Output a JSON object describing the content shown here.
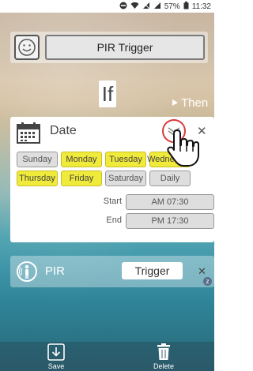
{
  "status_bar": {
    "battery_percent": "57%",
    "time": "11:32"
  },
  "header": {
    "title": "PIR Trigger",
    "icon": "smiley-face-icon"
  },
  "flow": {
    "if_label": "If",
    "then_label": "Then"
  },
  "date_condition": {
    "label": "Date",
    "days": [
      {
        "label": "Sunday",
        "selected": false
      },
      {
        "label": "Monday",
        "selected": true
      },
      {
        "label": "Tuesday",
        "selected": true
      },
      {
        "label": "Wednesday",
        "selected": true
      },
      {
        "label": "Thursday",
        "selected": true
      },
      {
        "label": "Friday",
        "selected": true
      },
      {
        "label": "Saturday",
        "selected": false
      },
      {
        "label": "Daily",
        "selected": false
      }
    ],
    "start_label": "Start",
    "start_value": "AM 07:30",
    "end_label": "End",
    "end_value": "PM 17:30"
  },
  "pir_trigger": {
    "label": "PIR",
    "value": "Trigger",
    "badge": "z"
  },
  "bottom_bar": {
    "save_label": "Save",
    "delete_label": "Delete"
  },
  "colors": {
    "selected_day": "#f0ea3a",
    "unselected_day": "#dedede",
    "highlight_ring": "#d93a3a"
  }
}
